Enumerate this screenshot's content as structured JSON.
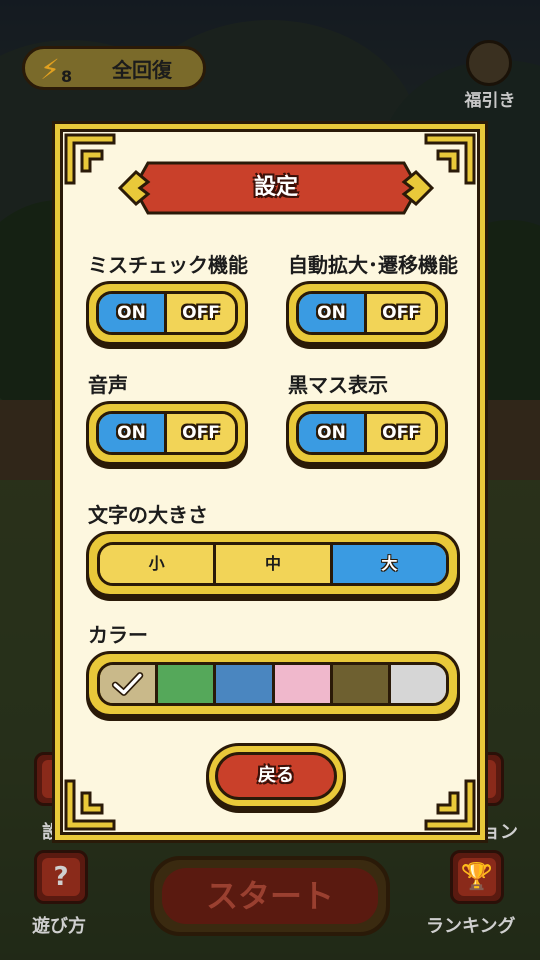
{
  "header": {
    "energy_icon": "lightning-icon",
    "energy_count": "8",
    "recover_label": "全回復",
    "gacha_label": "福引き"
  },
  "footer": {
    "left_top_label": "設",
    "right_top_label": "ョン",
    "howto_icon": "question-icon",
    "howto_label": "遊び方",
    "start_label": "スタート",
    "ranking_icon": "trophy-icon",
    "ranking_label": "ランキング"
  },
  "dialog": {
    "title": "設定",
    "miss_check": {
      "label": "ミスチェック機能",
      "on": "ON",
      "off": "OFF",
      "value": "ON"
    },
    "auto_zoom": {
      "label": "自動拡大･遷移機能",
      "on": "ON",
      "off": "OFF",
      "value": "ON"
    },
    "sound": {
      "label": "音声",
      "on": "ON",
      "off": "OFF",
      "value": "ON"
    },
    "black_cells": {
      "label": "黒マス表示",
      "on": "ON",
      "off": "OFF",
      "value": "ON"
    },
    "font_size": {
      "label": "文字の大きさ",
      "options": [
        "小",
        "中",
        "大"
      ],
      "selected": "大"
    },
    "color": {
      "label": "カラー",
      "swatches": [
        "#c9b98a",
        "#55a85a",
        "#4a86c0",
        "#f0b8cc",
        "#6e6030",
        "#d6d6d6"
      ],
      "selected_index": 0
    },
    "back_label": "戻る"
  },
  "colors": {
    "gold": "#e9c93a",
    "on_blue": "#3a9be2",
    "off_yellow": "#f2d457",
    "banner_red": "#c9402a",
    "panel_cream": "#fdf7df"
  }
}
